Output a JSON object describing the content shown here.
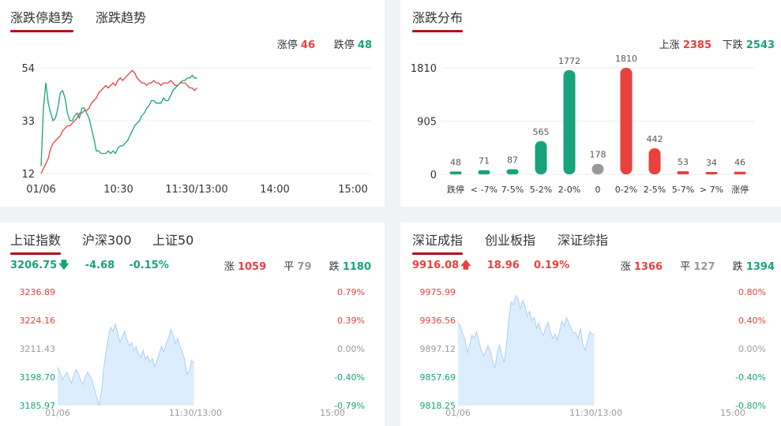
{
  "colors": {
    "up": "#e8413e",
    "down": "#17a37b",
    "flat": "#999999",
    "area": "#dceefd",
    "area_line": "#a9cff5",
    "accent": "#b3131b"
  },
  "trend_panel": {
    "tabs": [
      {
        "label": "涨跌停趋势",
        "active": true
      },
      {
        "label": "涨跌趋势",
        "active": false
      }
    ],
    "limit_up_label": "涨停",
    "limit_up_value": "46",
    "limit_down_label": "跌停",
    "limit_down_value": "48"
  },
  "dist_panel": {
    "tabs": [
      {
        "label": "涨跌分布",
        "active": true
      }
    ],
    "rise_label": "上涨",
    "rise_value": "2385",
    "fall_label": "下跌",
    "fall_value": "2543"
  },
  "sh_panel": {
    "tabs": [
      {
        "label": "上证指数",
        "active": true
      },
      {
        "label": "沪深300",
        "active": false
      },
      {
        "label": "上证50",
        "active": false
      }
    ],
    "price": "3206.75",
    "direction": "down-arrow-icon",
    "change": "-4.68",
    "change_pct": "-0.15%",
    "up_label": "涨",
    "up_value": "1059",
    "flat_label": "平",
    "flat_value": "79",
    "down_label": "跌",
    "down_value": "1180"
  },
  "sz_panel": {
    "tabs": [
      {
        "label": "深证成指",
        "active": true
      },
      {
        "label": "创业板指",
        "active": false
      },
      {
        "label": "深证综指",
        "active": false
      }
    ],
    "price": "9916.08",
    "direction": "up-arrow-icon",
    "change": "18.96",
    "change_pct": "0.19%",
    "up_label": "涨",
    "up_value": "1366",
    "flat_label": "平",
    "flat_value": "127",
    "down_label": "跌",
    "down_value": "1394"
  },
  "chart_data": [
    {
      "id": "limit-trend",
      "type": "line",
      "x_tick_labels": [
        "01/06",
        "10:30",
        "11:30/13:00",
        "14:00",
        "15:00"
      ],
      "y_tick_labels": [
        "54",
        "33",
        "12"
      ],
      "ylim": [
        12,
        54
      ],
      "grid": true,
      "session_minutes": 240,
      "series": [
        {
          "name": "涨停",
          "color": "#e8413e",
          "values": [
            12,
            14,
            16,
            18,
            22,
            24,
            25,
            26,
            27,
            29,
            30,
            31,
            31,
            32,
            33,
            34,
            36,
            36,
            37,
            37,
            38,
            40,
            41,
            42,
            44,
            45,
            46,
            47,
            46,
            47,
            48,
            47,
            49,
            50,
            49,
            50,
            51,
            52,
            53,
            52,
            50,
            49,
            48,
            48,
            47,
            48,
            48,
            49,
            48,
            48,
            47,
            48,
            48,
            48,
            49,
            48,
            47,
            47,
            48,
            48,
            48,
            47,
            46,
            46,
            45,
            46
          ]
        },
        {
          "name": "跌停",
          "color": "#17a37b",
          "values": [
            15,
            38,
            48,
            40,
            36,
            33,
            34,
            38,
            44,
            45,
            42,
            36,
            33,
            33,
            35,
            36,
            34,
            38,
            38,
            36,
            34,
            30,
            26,
            21,
            21,
            20,
            20,
            20,
            21,
            20,
            21,
            20,
            22,
            23,
            23,
            24,
            25,
            27,
            29,
            31,
            32,
            33,
            35,
            36,
            38,
            39,
            41,
            41,
            40,
            40,
            40,
            42,
            41,
            41,
            43,
            45,
            46,
            47,
            48,
            49,
            49,
            50,
            50,
            51,
            50,
            50
          ]
        }
      ]
    },
    {
      "id": "distribution",
      "type": "bar",
      "categories": [
        "跌停",
        "< -7%",
        "7-5%",
        "5-2%",
        "2-0%",
        "0",
        "0-2%",
        "2-5%",
        "5-7%",
        "> 7%",
        "涨停"
      ],
      "values": [
        48,
        71,
        87,
        565,
        1772,
        178,
        1810,
        442,
        53,
        34,
        46
      ],
      "colors": [
        "#17a37b",
        "#17a37b",
        "#17a37b",
        "#17a37b",
        "#17a37b",
        "#999999",
        "#e8413e",
        "#e8413e",
        "#e8413e",
        "#e8413e",
        "#e8413e"
      ],
      "y_tick_labels": [
        "1810",
        "905",
        "0"
      ],
      "ylim": [
        0,
        1810
      ],
      "grid": true
    },
    {
      "id": "sh-index",
      "type": "area",
      "x_tick_labels": [
        "01/06",
        "11:30/13:00",
        "15:00"
      ],
      "y_tick_labels_left": [
        "3236.89",
        "3224.16",
        "3211.43",
        "3198.70",
        "3185.97"
      ],
      "y_tick_labels_right": [
        "0.79%",
        "0.39%",
        "0.00%",
        "-0.40%",
        "-0.79%"
      ],
      "ylim": [
        3185.97,
        3236.89
      ],
      "prev_close": 3211.43,
      "session_minutes": 240,
      "values": [
        3203.1,
        3201.0,
        3197.5,
        3199.2,
        3200.8,
        3198.1,
        3196.0,
        3199.5,
        3202.1,
        3200.3,
        3197.2,
        3195.4,
        3198.6,
        3201.0,
        3199.3,
        3196.8,
        3193.2,
        3189.5,
        3186.0,
        3192.5,
        3203.0,
        3210.2,
        3216.5,
        3221.0,
        3219.2,
        3222.4,
        3218.5,
        3214.2,
        3217.0,
        3219.3,
        3215.6,
        3212.8,
        3214.1,
        3210.5,
        3212.3,
        3209.0,
        3207.5,
        3210.6,
        3206.8,
        3208.2,
        3205.4,
        3206.9,
        3203.5,
        3206.0,
        3209.4,
        3212.5,
        3210.0,
        3213.6,
        3216.2,
        3220.1,
        3217.5,
        3213.8,
        3216.0,
        3212.4,
        3210.0,
        3206.5,
        3200.0,
        3201.5,
        3206.2,
        3205.0
      ]
    },
    {
      "id": "sz-index",
      "type": "area",
      "x_tick_labels": [
        "01/06",
        "11:30/13:00",
        "15:00"
      ],
      "y_tick_labels_left": [
        "9975.99",
        "9936.56",
        "9897.12",
        "9857.69",
        "9818.25"
      ],
      "y_tick_labels_right": [
        "0.80%",
        "0.40%",
        "0.00%",
        "-0.40%",
        "-0.80%"
      ],
      "ylim": [
        9818.25,
        9975.99
      ],
      "prev_close": 9897.12,
      "session_minutes": 240,
      "values": [
        9933.0,
        9928.5,
        9918.0,
        9910.2,
        9892.0,
        9900.5,
        9915.6,
        9912.0,
        9920.4,
        9908.3,
        9895.1,
        9887.0,
        9893.5,
        9901.2,
        9894.0,
        9880.5,
        9870.2,
        9891.0,
        9902.6,
        9888.4,
        9878.0,
        9902.5,
        9938.0,
        9962.3,
        9958.5,
        9971.0,
        9966.4,
        9952.0,
        9964.2,
        9955.8,
        9942.0,
        9949.1,
        9936.0,
        9940.5,
        9925.4,
        9932.6,
        9920.0,
        9915.5,
        9927.3,
        9933.8,
        9920.0,
        9911.2,
        9917.5,
        9909.0,
        9921.6,
        9935.4,
        9928.0,
        9940.2,
        9932.5,
        9925.0,
        9918.3,
        9920.0,
        9910.5,
        9925.4,
        9904.0,
        9895.0,
        9906.5,
        9920.2,
        9918.0,
        9916.1
      ]
    }
  ]
}
